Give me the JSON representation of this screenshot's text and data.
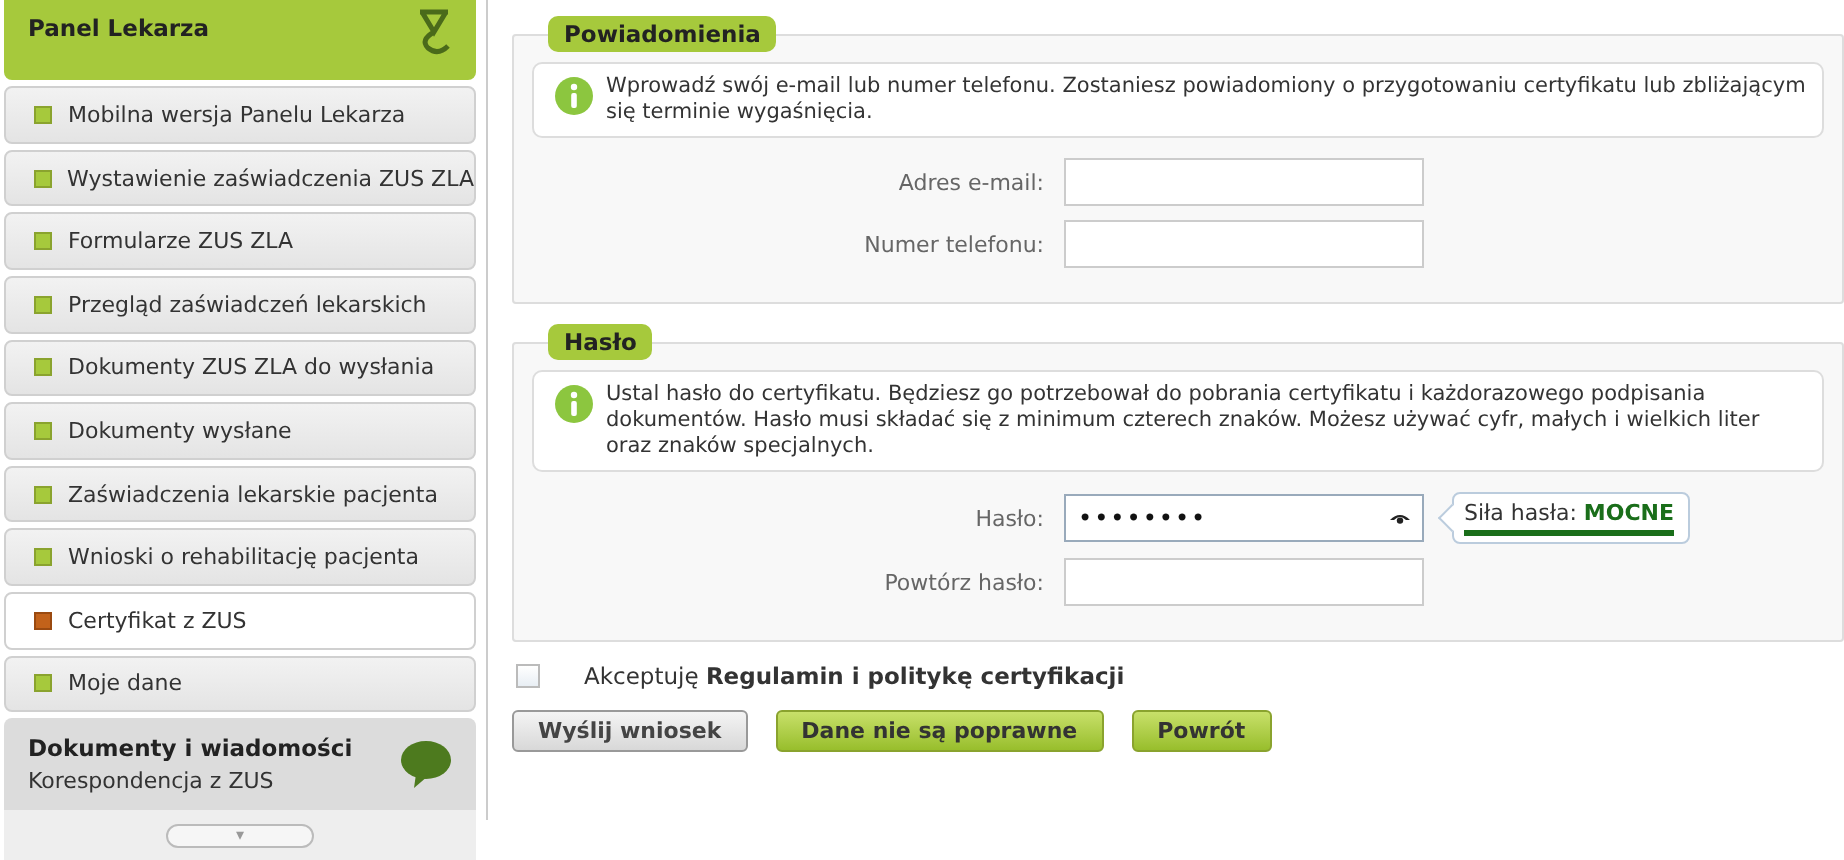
{
  "sidebar": {
    "title": "Panel Lekarza",
    "items": [
      {
        "label": "Mobilna wersja Panelu Lekarza",
        "selected": false
      },
      {
        "label": "Wystawienie zaświadczenia ZUS ZLA",
        "selected": false
      },
      {
        "label": "Formularze ZUS ZLA",
        "selected": false
      },
      {
        "label": "Przegląd zaświadczeń lekarskich",
        "selected": false
      },
      {
        "label": "Dokumenty ZUS ZLA do wysłania",
        "selected": false
      },
      {
        "label": "Dokumenty wysłane",
        "selected": false
      },
      {
        "label": "Zaświadczenia lekarskie pacjenta",
        "selected": false
      },
      {
        "label": "Wnioski o rehabilitację pacjenta",
        "selected": false
      },
      {
        "label": "Certyfikat z ZUS",
        "selected": true
      },
      {
        "label": "Moje dane",
        "selected": false
      }
    ],
    "section": {
      "title": "Dokumenty i wiadomości",
      "subtitle": "Korespondencja z ZUS"
    },
    "scroll_button": "▾"
  },
  "notifications": {
    "legend": "Powiadomienia",
    "info": "Wprowadź swój e-mail lub numer telefonu. Zostaniesz powiadomiony o przygotowaniu certyfikatu lub zbliżającym się terminie wygaśnięcia.",
    "fields": [
      {
        "label": "Adres e-mail:"
      },
      {
        "label": "Numer telefonu:"
      }
    ]
  },
  "password": {
    "legend": "Hasło",
    "info": "Ustal hasło do certyfikatu. Będziesz go potrzebował do pobrania certyfikatu i każdorazowego podpisania dokumentów. Hasło musi składać się z minimum czterech znaków. Możesz używać cyfr, małych i wielkich liter oraz znaków specjalnych.",
    "fields": [
      {
        "label": "Hasło:",
        "value": "••••••••",
        "kind": "password"
      },
      {
        "label": "Powtórz hasło:",
        "kind": "text"
      }
    ],
    "strength": {
      "text": "Siła hasła: **MOCNE**",
      "level": 1
    }
  },
  "accept": {
    "text": "Akceptuję **Regulamin i politykę certyfikacji**",
    "checked": false
  },
  "buttons": [
    {
      "label": "Wyślij wniosek",
      "kind": "secondary"
    },
    {
      "label": "Dane nie są poprawne",
      "kind": "primary"
    },
    {
      "label": "Powrót",
      "kind": "primary"
    }
  ]
}
